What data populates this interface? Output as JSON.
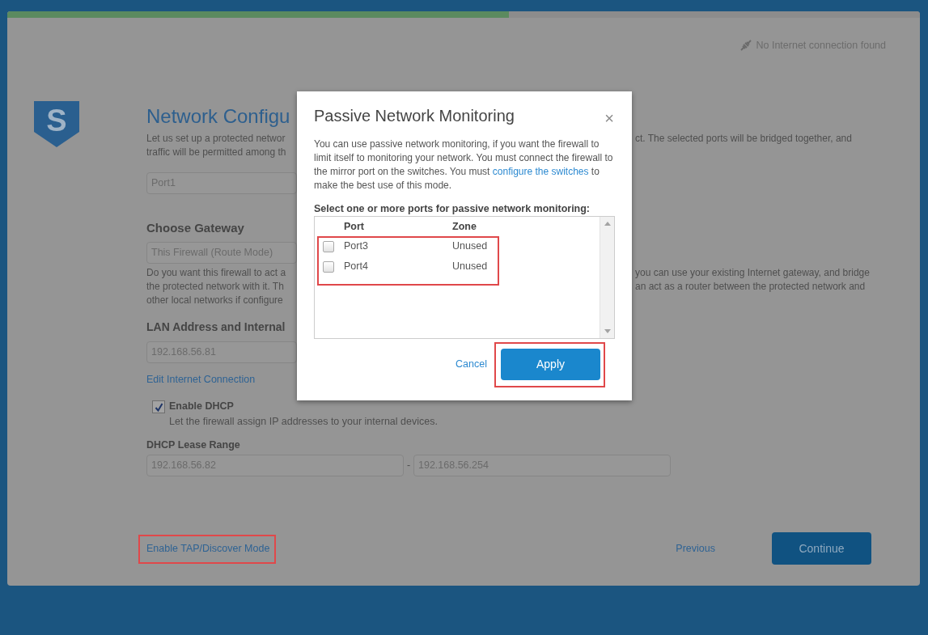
{
  "progress": {
    "level": 0.55
  },
  "connection_status": "No Internet connection found",
  "logo": {
    "letter": "S"
  },
  "page": {
    "title": "Network Configu",
    "intro": {
      "left": [
        "Let us set up a protected networ",
        "traffic will be permitted among th"
      ],
      "right": [
        "ct. The selected ports will be bridged together, and"
      ]
    },
    "port_field": {
      "value": "Port1"
    },
    "gateway": {
      "heading": "Choose Gateway",
      "value": "This Firewall (Route Mode)",
      "description_left": [
        "Do you want this firewall to act a",
        "the protected network with it. Th",
        "other local networks if configure"
      ],
      "description_right": [
        "you can use your existing Internet gateway, and bridge",
        "an act as a router between the protected network and"
      ]
    },
    "lan": {
      "heading": "LAN Address and Internal",
      "value": "192.168.56.81",
      "link": "Edit Internet Connection"
    },
    "dhcp": {
      "label": "Enable DHCP",
      "checked": true,
      "hint": "Let the firewall assign IP addresses to your internal devices."
    },
    "lease": {
      "heading": "DHCP Lease Range",
      "start": "192.168.56.82",
      "separator": "-",
      "end": "192.168.56.254"
    },
    "tap_link": {
      "label": "Enable TAP/Discover Mode",
      "highlighted": true
    },
    "previous": "Previous",
    "continue": "Continue"
  },
  "dialog": {
    "title": "Passive Network Monitoring",
    "close": "×",
    "text_before": "You can use passive network monitoring, if you want the firewall to limit itself to monitoring your network. You must connect the firewall to the mirror port on the switches. You must ",
    "link": "configure the switches",
    "text_after": " to make the best use of this mode.",
    "prompt": "Select one or more ports for passive network monitoring:",
    "columns": [
      "Port",
      "Zone"
    ],
    "rows": [
      {
        "port": "Port3",
        "zone": "Unused",
        "checked": false
      },
      {
        "port": "Port4",
        "zone": "Unused",
        "checked": false
      }
    ],
    "rows_highlighted": true,
    "cancel": "Cancel",
    "apply": {
      "label": "Apply",
      "highlighted": true
    }
  }
}
